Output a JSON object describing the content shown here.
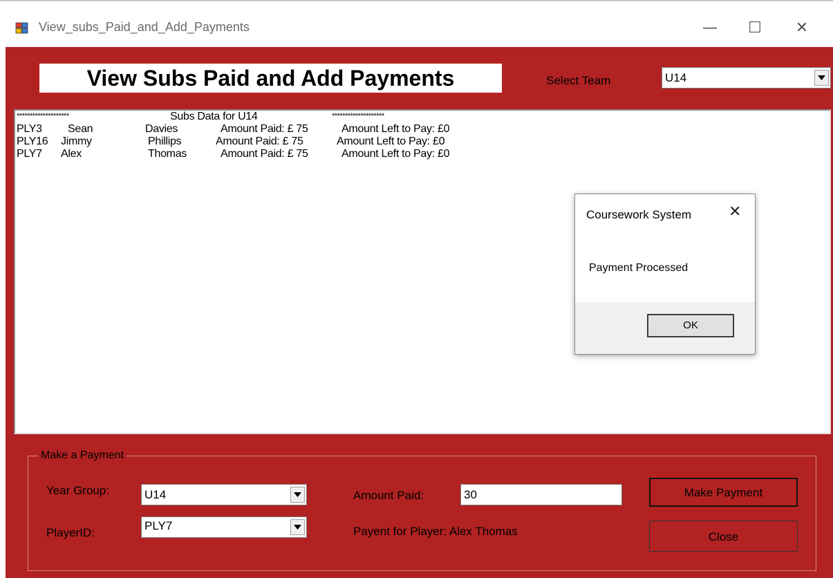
{
  "window": {
    "title": "View_subs_Paid_and_Add_Payments",
    "minimize_glyph": "—",
    "maximize_glyph": "☐",
    "close_glyph": "✕"
  },
  "header": {
    "heading": "View Subs Paid and Add Payments",
    "select_team_label": "Select Team",
    "team_value": "U14"
  },
  "subs": {
    "stars_left": "********************",
    "title": "Subs Data for U14",
    "stars_right": "********************",
    "rows": [
      {
        "id": "PLY3",
        "first": "Sean",
        "last": "Davies",
        "paid": "Amount Paid: £ 75",
        "left": "Amount Left to Pay: £0"
      },
      {
        "id": "PLY16",
        "first": "Jimmy",
        "last": "Phillips",
        "paid": "Amount Paid: £ 75",
        "left": "Amount Left to Pay: £0"
      },
      {
        "id": "PLY7",
        "first": "Alex",
        "last": "Thomas",
        "paid": "Amount Paid: £ 75",
        "left": "Amount Left to Pay: £0"
      }
    ]
  },
  "payment": {
    "legend": "Make a Payment",
    "year_group_label": "Year Group:",
    "year_group_value": "U14",
    "player_id_label": "PlayerID:",
    "player_id_value": "PLY7",
    "amount_label": "Amount Paid:",
    "amount_value": "30",
    "payment_for": "Payent for Player: Alex Thomas",
    "make_payment_label": "Make Payment",
    "close_label": "Close"
  },
  "dialog": {
    "title": "Coursework System",
    "close_glyph": "✕",
    "message": "Payment Processed",
    "ok_label": "OK"
  },
  "colors": {
    "form_background": "#b22222"
  }
}
